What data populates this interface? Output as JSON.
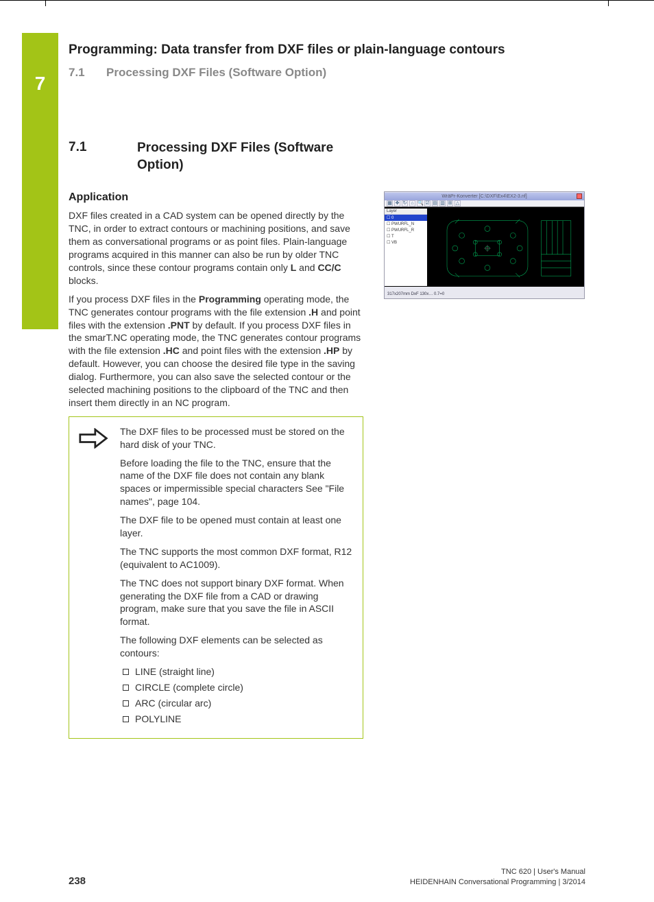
{
  "chapter": {
    "number": "7",
    "title": "Programming: Data transfer from DXF files or plain-language contours",
    "sub_number": "7.1",
    "sub_title": "Processing DXF Files (Software Option)"
  },
  "section": {
    "number": "7.1",
    "title": "Processing DXF Files (Software Option)"
  },
  "subhead": "Application",
  "para1_a": "DXF files created in a CAD system can be opened directly by the TNC, in order to extract contours or machining positions, and save them as conversational programs or as point files. Plain-language programs acquired in this manner can also be run by older TNC controls, since these contour programs contain only ",
  "para1_b1": "L",
  "para1_c": " and ",
  "para1_b2": "CC/C",
  "para1_d": " blocks.",
  "para2_a": "If you process DXF files in the ",
  "para2_b1": "Programming",
  "para2_c": " operating mode, the TNC generates contour programs with the file extension ",
  "para2_b2": ".H",
  "para2_d": " and point files with the extension ",
  "para2_b3": ".PNT",
  "para2_e": " by default. If you process DXF files in the smarT.NC operating mode, the TNC generates contour programs with the file extension ",
  "para2_b4": ".HC",
  "para2_f": " and point files with the extension ",
  "para2_b5": ".HP",
  "para2_g": " by default. However, you can choose the desired file type in the saving dialog. Furthermore, you can also save the selected contour or the selected machining positions to the clipboard of the TNC and then insert them directly in an NC program.",
  "note": {
    "p1": "The DXF files to be processed must be stored on the hard disk of your TNC.",
    "p2": "Before loading the file to the TNC, ensure that the name of the DXF file does not contain any blank spaces or impermissible special characters See \"File names\", page 104.",
    "p3": "The DXF file to be opened must contain at least one layer.",
    "p4": "The TNC supports the most common DXF format, R12 (equivalent to AC1009).",
    "p5": "The TNC does not support binary DXF format. When generating the DXF file from a CAD or drawing program, make sure that you save the file in ASCII format.",
    "p6": "The following DXF elements can be selected as contours:",
    "items": [
      "LINE (straight line)",
      "CIRCLE (complete circle)",
      "ARC (circular arc)",
      "POLYLINE"
    ]
  },
  "cad": {
    "title": "WräPr-Konverter [C:\\DXF\\Ex4\\EX2-3.nf]",
    "layer_header": "Layer",
    "layer_sel": "0",
    "layers": [
      "PWURFL_N",
      "PWURFL_R",
      "T",
      "VB"
    ],
    "status": "317x207mm  DxF    130x…   0.7=0"
  },
  "footer": {
    "page": "238",
    "meta1": "TNC 620 | User's Manual",
    "meta2": "HEIDENHAIN Conversational Programming | 3/2014"
  }
}
